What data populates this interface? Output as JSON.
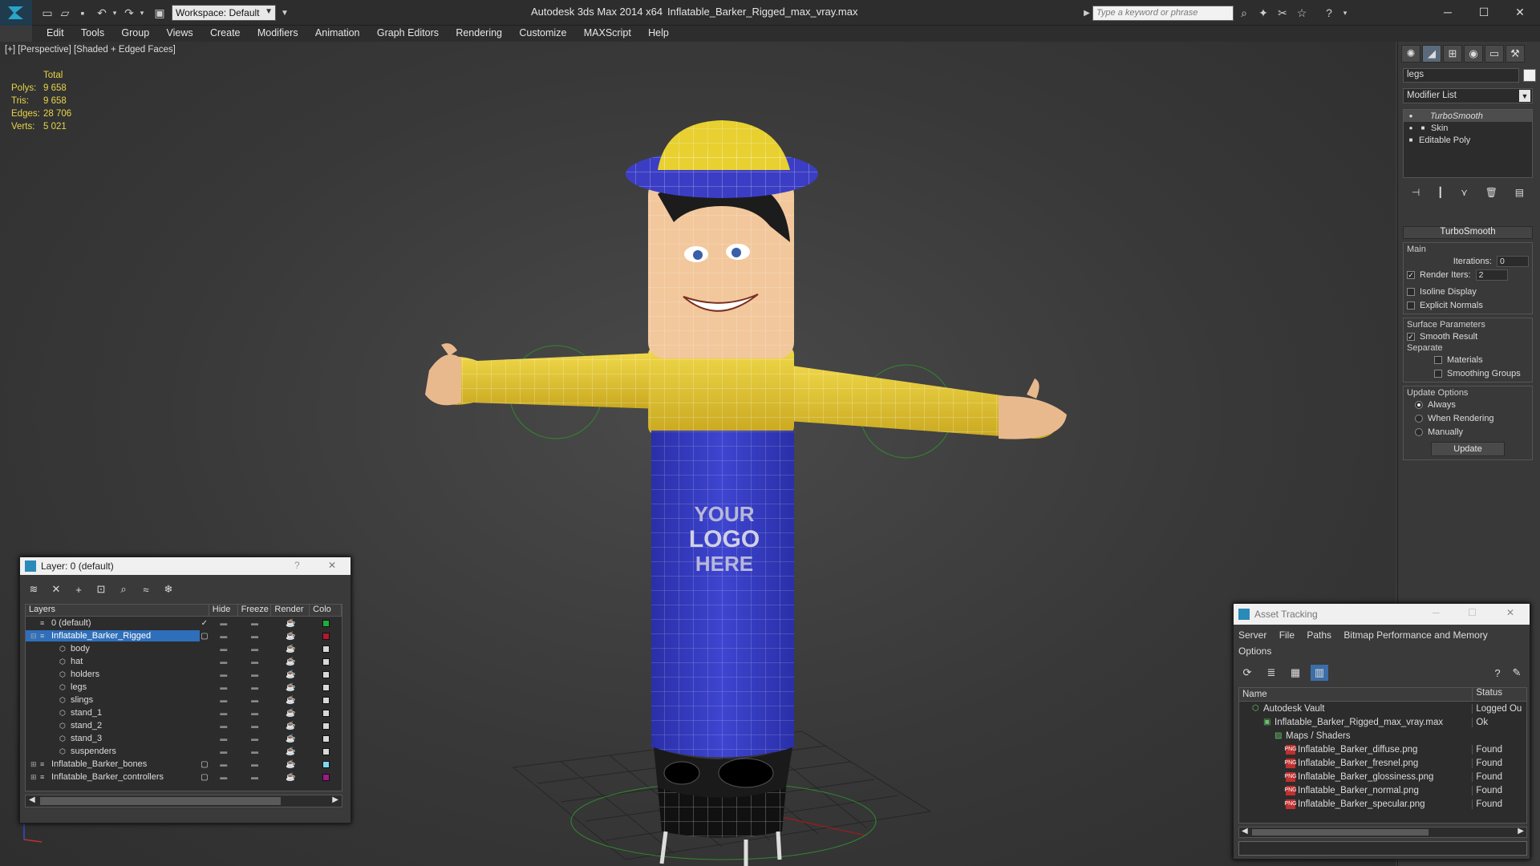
{
  "titlebar": {
    "workspace": "Workspace: Default",
    "app_title": "Autodesk 3ds Max  2014 x64",
    "file_title": "Inflatable_Barker_Rigged_max_vray.max",
    "search_placeholder": "Type a keyword or phrase"
  },
  "menu": [
    "Edit",
    "Tools",
    "Group",
    "Views",
    "Create",
    "Modifiers",
    "Animation",
    "Graph Editors",
    "Rendering",
    "Customize",
    "MAXScript",
    "Help"
  ],
  "viewport": {
    "label": "[+] [Perspective] [Shaded + Edged Faces]",
    "stats_header": "Total",
    "stats": [
      {
        "label": "Polys:",
        "value": "9 658"
      },
      {
        "label": "Tris:",
        "value": "9 658"
      },
      {
        "label": "Edges:",
        "value": "28 706"
      },
      {
        "label": "Verts:",
        "value": "5 021"
      }
    ],
    "logo_text": [
      "YOUR",
      "LOGO",
      "HERE"
    ]
  },
  "command_panel": {
    "object_name": "legs",
    "modifier_list": "Modifier List",
    "stack": [
      "TurboSmooth",
      "Skin",
      "Editable Poly"
    ],
    "rollout_title": "TurboSmooth",
    "main_group": "Main",
    "iterations_label": "Iterations:",
    "iterations_value": "0",
    "render_iters_label": "Render Iters:",
    "render_iters_value": "2",
    "isoline": "Isoline Display",
    "explicit_normals": "Explicit Normals",
    "surface_group": "Surface Parameters",
    "smooth_result": "Smooth Result",
    "separate": "Separate",
    "materials": "Materials",
    "smoothing_groups": "Smoothing Groups",
    "update_group": "Update Options",
    "always": "Always",
    "when_rendering": "When Rendering",
    "manually": "Manually",
    "update_btn": "Update"
  },
  "layer_dialog": {
    "title": "Layer: 0 (default)",
    "help": "?",
    "close": "✕",
    "columns": [
      "Layers",
      "Hide",
      "Freeze",
      "Render",
      "Colo"
    ],
    "rows": [
      {
        "name": "0 (default)",
        "indent": 1,
        "color": "#1fae3a"
      },
      {
        "name": "Inflatable_Barker_Rigged",
        "indent": 1,
        "color": "#b0192e"
      },
      {
        "name": "body",
        "indent": 2,
        "color": "#d8d8d8"
      },
      {
        "name": "hat",
        "indent": 2,
        "color": "#d8d8d8"
      },
      {
        "name": "holders",
        "indent": 2,
        "color": "#d8d8d8"
      },
      {
        "name": "legs",
        "indent": 2,
        "color": "#d8d8d8"
      },
      {
        "name": "slings",
        "indent": 2,
        "color": "#d8d8d8"
      },
      {
        "name": "stand_1",
        "indent": 2,
        "color": "#d8d8d8"
      },
      {
        "name": "stand_2",
        "indent": 2,
        "color": "#d8d8d8"
      },
      {
        "name": "stand_3",
        "indent": 2,
        "color": "#d8d8d8"
      },
      {
        "name": "suspenders",
        "indent": 2,
        "color": "#d8d8d8"
      },
      {
        "name": "Inflatable_Barker_bones",
        "indent": 1,
        "color": "#7fd7f0"
      },
      {
        "name": "Inflatable_Barker_controllers",
        "indent": 1,
        "color": "#a0188a"
      }
    ]
  },
  "asset_dialog": {
    "title": "Asset Tracking",
    "menu": [
      "Server",
      "File",
      "Paths",
      "Bitmap Performance and Memory"
    ],
    "menu2": "Options",
    "columns": [
      "Name",
      "Status"
    ],
    "rows": [
      {
        "name": "Autodesk Vault",
        "status": "Logged Ou"
      },
      {
        "name": "Inflatable_Barker_Rigged_max_vray.max",
        "status": "Ok"
      },
      {
        "name": "Maps / Shaders",
        "status": ""
      },
      {
        "name": "Inflatable_Barker_diffuse.png",
        "status": "Found"
      },
      {
        "name": "Inflatable_Barker_fresnel.png",
        "status": "Found"
      },
      {
        "name": "Inflatable_Barker_glossiness.png",
        "status": "Found"
      },
      {
        "name": "Inflatable_Barker_normal.png",
        "status": "Found"
      },
      {
        "name": "Inflatable_Barker_specular.png",
        "status": "Found"
      }
    ]
  }
}
